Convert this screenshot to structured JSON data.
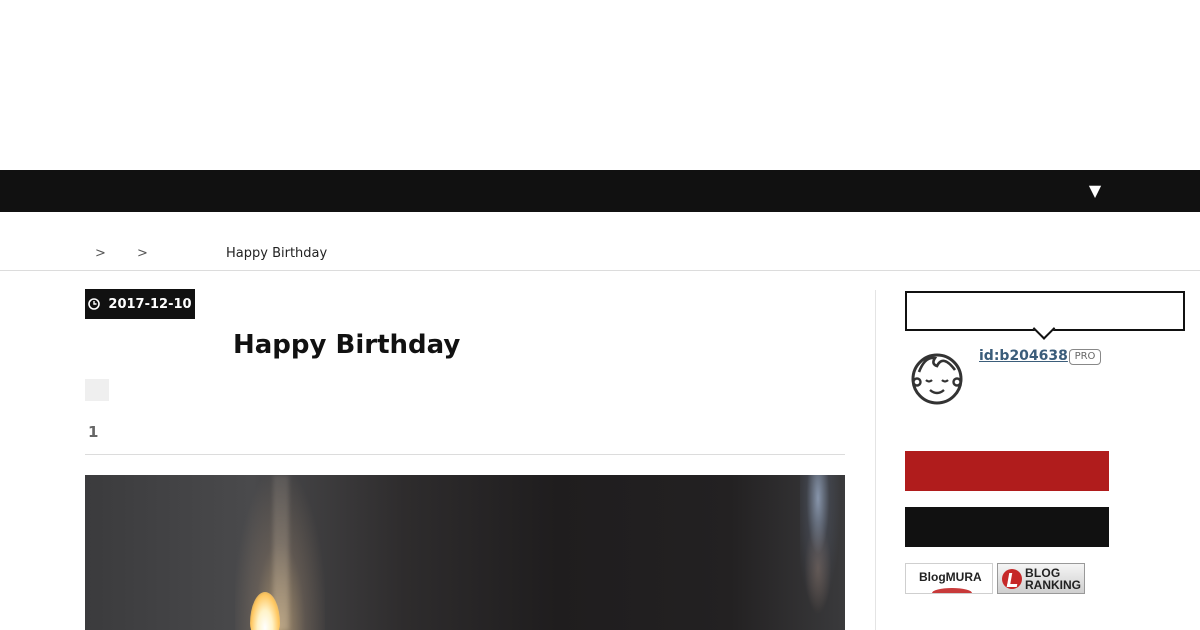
{
  "nav": {
    "toggle_glyph": "▼"
  },
  "breadcrumb": {
    "items": [
      {
        "label": "",
        "separator": ">"
      },
      {
        "label": "",
        "separator": ">"
      }
    ],
    "current": "Happy Birthday"
  },
  "entry": {
    "date": "2017-12-10",
    "title": "Happy Birthday",
    "comment_count": "1"
  },
  "sidebar": {
    "profile_id": "id:b204638",
    "pro_label": "PRO",
    "banners": [
      {
        "name": "blogmura",
        "label": "BlogMURA"
      },
      {
        "name": "blog-ranking",
        "line1": "BLOG",
        "line2": "RANKING"
      }
    ]
  },
  "colors": {
    "nav_bg": "#111111",
    "accent_red": "#b01c1c",
    "link": "#3b5d7a"
  }
}
